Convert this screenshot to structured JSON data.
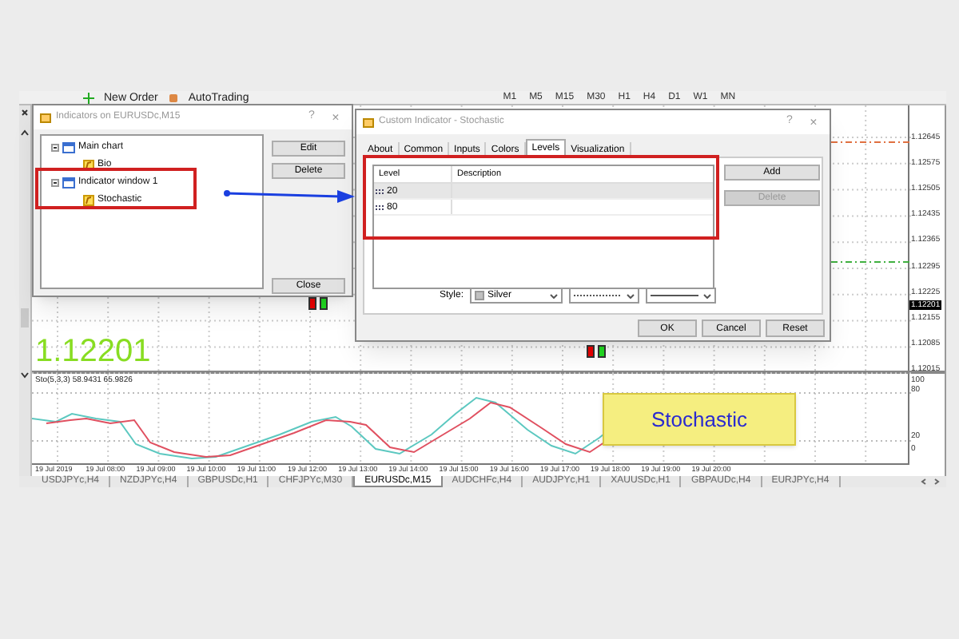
{
  "toolbar": {
    "items": [
      {
        "label": "New Order"
      },
      {
        "label": "AutoTrading"
      }
    ],
    "timeframes": [
      "M1",
      "M5",
      "M15",
      "M30",
      "H1",
      "H4",
      "D1",
      "W1",
      "MN"
    ]
  },
  "chart": {
    "price_labels": [
      "1.12645",
      "1.12575",
      "1.12505",
      "1.12435",
      "1.12365",
      "1.12295",
      "1.12225",
      "1.12155",
      "1.12085",
      "1.12015"
    ],
    "current_price": "1.12201",
    "big_price": "1.12201",
    "indicator_label": "Sto(5,3,3) 58.9431 65.9826",
    "indicator_scale": [
      "100",
      "80",
      "20",
      "0"
    ],
    "time_labels": [
      "19 Jul 2019",
      "19 Jul 08:00",
      "19 Jul 09:00",
      "19 Jul 10:00",
      "19 Jul 11:00",
      "19 Jul 12:00",
      "19 Jul 13:00",
      "19 Jul 14:00",
      "19 Jul 15:00",
      "19 Jul 16:00",
      "19 Jul 17:00",
      "19 Jul 18:00",
      "19 Jul 19:00",
      "19 Jul 20:00"
    ],
    "callout": "Stochastic"
  },
  "indicators_dialog": {
    "title": "Indicators on EURUSDc,M15",
    "title_buttons": [
      "?",
      "×"
    ],
    "tree": [
      {
        "label": "Main chart",
        "expanded": true,
        "children": [
          {
            "label": "Bio"
          }
        ]
      },
      {
        "label": "Indicator window 1",
        "expanded": true,
        "children": [
          {
            "label": "Stochastic"
          }
        ]
      }
    ],
    "buttons": [
      "Edit",
      "Delete",
      "Close"
    ]
  },
  "custom_indicator_dialog": {
    "title": "Custom Indicator - Stochastic",
    "title_buttons": [
      "?",
      "×"
    ],
    "tabs": [
      {
        "label": "About",
        "selected": false
      },
      {
        "label": "Common",
        "selected": false
      },
      {
        "label": "Inputs",
        "selected": false
      },
      {
        "label": "Colors",
        "selected": false
      },
      {
        "label": "Levels",
        "selected": true
      },
      {
        "label": "Visualization",
        "selected": false
      }
    ],
    "columns": [
      "Level",
      "Description"
    ],
    "rows": [
      {
        "level": "20",
        "selected": true
      },
      {
        "level": "80",
        "selected": false
      }
    ],
    "side_buttons": [
      {
        "label": "Add",
        "disabled": false
      },
      {
        "label": "Delete",
        "disabled": true
      }
    ],
    "style_label": "Style:",
    "style_color": "Silver",
    "buttons": [
      "OK",
      "Cancel",
      "Reset"
    ]
  },
  "symbol_tabs": [
    {
      "label": "USDJPYc,H4",
      "selected": false
    },
    {
      "label": "NZDJPYc,H4",
      "selected": false
    },
    {
      "label": "GBPUSDc,H1",
      "selected": false
    },
    {
      "label": "CHFJPYc,M30",
      "selected": false
    },
    {
      "label": "EURUSDc,M15",
      "selected": true
    },
    {
      "label": "AUDCHFc,H4",
      "selected": false
    },
    {
      "label": "AUDJPYc,H1",
      "selected": false
    },
    {
      "label": "XAUUSDc,H1",
      "selected": false
    },
    {
      "label": "GBPAUDc,H4",
      "selected": false
    },
    {
      "label": "EURJPYc,H4",
      "selected": false
    }
  ]
}
